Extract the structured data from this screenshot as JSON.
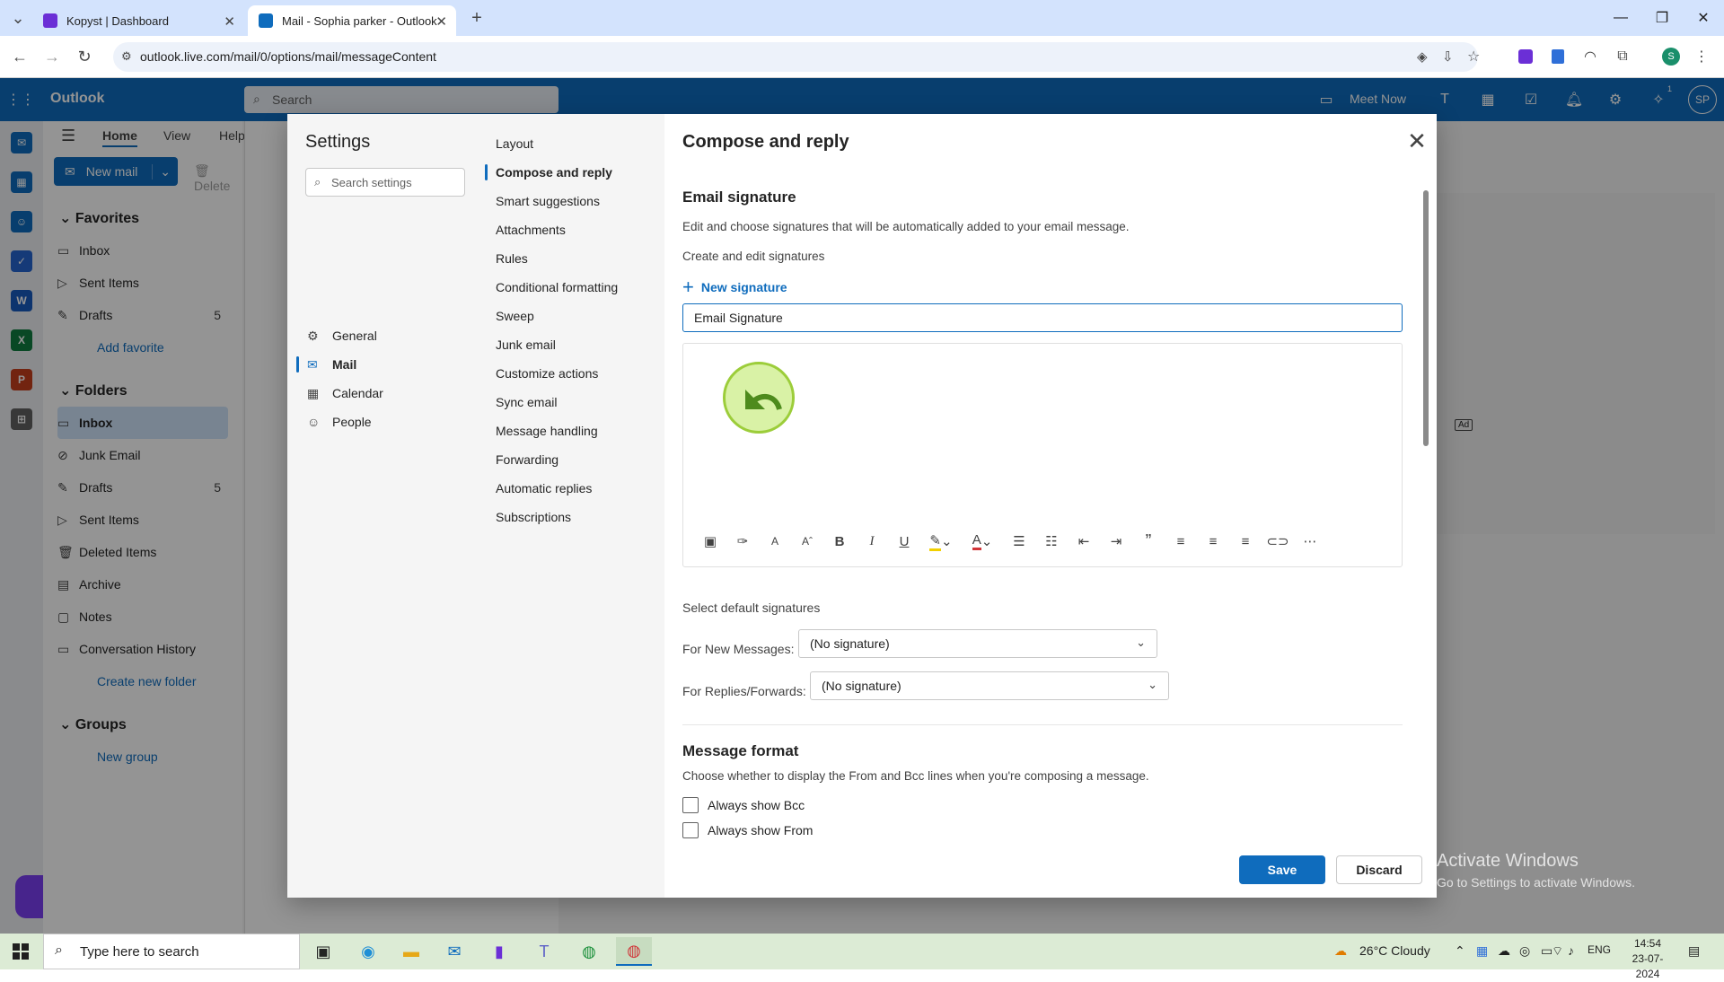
{
  "browser": {
    "tabs": [
      {
        "title": "Kopyst | Dashboard",
        "icon": "kopyst-icon"
      },
      {
        "title": "Mail - Sophia parker - Outlook",
        "icon": "outlook-icon"
      }
    ],
    "url": "outlook.live.com/mail/0/options/mail/messageContent"
  },
  "outlook": {
    "brand": "Outlook",
    "search_placeholder": "Search",
    "meet_now": "Meet Now",
    "avatar_initials": "SP",
    "notification_count": "1",
    "ribbon_tabs": [
      "Home",
      "View",
      "Help"
    ],
    "new_mail": "New mail",
    "delete": "Delete",
    "favorites_heading": "Favorites",
    "favorites": [
      {
        "label": "Inbox",
        "count": ""
      },
      {
        "label": "Sent Items",
        "count": ""
      },
      {
        "label": "Drafts",
        "count": "5"
      }
    ],
    "add_favorite": "Add favorite",
    "folders_heading": "Folders",
    "folders": [
      {
        "label": "Inbox",
        "count": ""
      },
      {
        "label": "Junk Email",
        "count": ""
      },
      {
        "label": "Drafts",
        "count": "5"
      },
      {
        "label": "Sent Items",
        "count": ""
      },
      {
        "label": "Deleted Items",
        "count": ""
      },
      {
        "label": "Archive",
        "count": ""
      },
      {
        "label": "Notes",
        "count": ""
      },
      {
        "label": "Conversation History",
        "count": ""
      }
    ],
    "create_folder": "Create new folder",
    "groups_heading": "Groups",
    "new_group": "New group",
    "ad_label": "Ad"
  },
  "settings": {
    "title": "Settings",
    "search_placeholder": "Search settings",
    "categories": [
      "General",
      "Mail",
      "Calendar",
      "People"
    ],
    "subcategories": [
      "Layout",
      "Compose and reply",
      "Smart suggestions",
      "Attachments",
      "Rules",
      "Conditional formatting",
      "Sweep",
      "Junk email",
      "Customize actions",
      "Sync email",
      "Message handling",
      "Forwarding",
      "Automatic replies",
      "Subscriptions"
    ],
    "pane_title": "Compose and reply",
    "signature": {
      "heading": "Email signature",
      "description": "Edit and choose signatures that will be automatically added to your email message.",
      "create_edit": "Create and edit signatures",
      "new_signature": "New signature",
      "name_value": "Email Signature"
    },
    "defaults": {
      "heading": "Select default signatures",
      "new_messages_label": "For New Messages:",
      "new_messages_value": "(No signature)",
      "replies_label": "For Replies/Forwards:",
      "replies_value": "(No signature)"
    },
    "message_format": {
      "heading": "Message format",
      "description": "Choose whether to display the From and Bcc lines when you're composing a message.",
      "always_bcc": "Always show Bcc",
      "always_from": "Always show From"
    },
    "save": "Save",
    "discard": "Discard"
  },
  "windows": {
    "activate_title": "Activate Windows",
    "activate_sub": "Go to Settings to activate Windows.",
    "search_placeholder": "Type here to search",
    "weather": "26°C  Cloudy",
    "lang": "ENG",
    "time": "14:54",
    "date": "23-07-2024"
  },
  "colors": {
    "outlook_blue": "#0f6cbd",
    "taskbar": "#dcebd5",
    "tab_strip": "#d3e3fd"
  }
}
